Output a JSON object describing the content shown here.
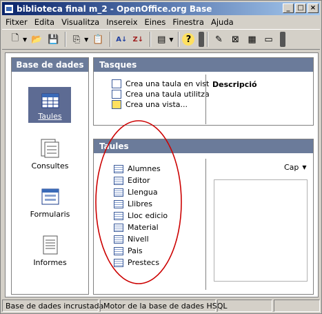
{
  "window": {
    "title": "biblioteca final m_2 - OpenOffice.org Base"
  },
  "menu": [
    "Fitxer",
    "Edita",
    "Visualitza",
    "Insereix",
    "Eines",
    "Finestra",
    "Ajuda"
  ],
  "left": {
    "header": "Base de dades",
    "items": [
      "Taules",
      "Consultes",
      "Formularis",
      "Informes"
    ],
    "selected": "Taules"
  },
  "tasks": {
    "header": "Tasques",
    "items": [
      "Crea una taula en vist",
      "Crea una taula utilitza",
      "Crea una vista..."
    ],
    "description_label": "Descripció"
  },
  "tables": {
    "header": "Taules",
    "items": [
      "Alumnes",
      "Editor",
      "Llengua",
      "Llibres",
      "Lloc edicio",
      "Material",
      "Nivell",
      "Pais",
      "Prestecs"
    ],
    "preview_label": "Cap"
  },
  "status": {
    "left": "Base de dades incrustada",
    "right": "Motor de la base de dades HSQL"
  },
  "colors": {
    "title_start": "#0a246a",
    "header_bg": "#6b7b9a",
    "selected": "#5d6b93",
    "annotation": "#cc0000"
  }
}
